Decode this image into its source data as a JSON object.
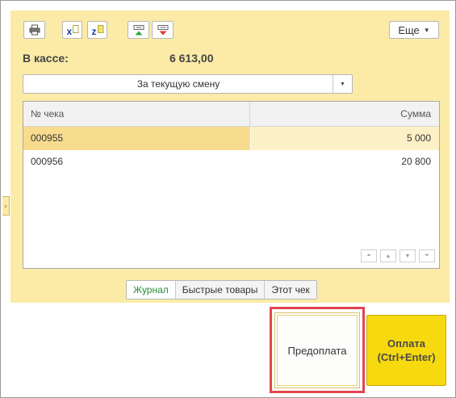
{
  "toolbar": {
    "icons": [
      "printer-icon",
      "excel-export-icon",
      "mxl-export-icon",
      "arrow-up-icon",
      "arrow-down-icon"
    ],
    "more_label": "Еще"
  },
  "cash": {
    "label": "В кассе:",
    "value": "6 613,00"
  },
  "period": {
    "selected": "За текущую смену"
  },
  "table": {
    "columns": [
      "№ чека",
      "Сумма"
    ],
    "rows": [
      {
        "number": "000955",
        "amount": "5 000",
        "selected": true
      },
      {
        "number": "000956",
        "amount": "20 800",
        "selected": false
      }
    ]
  },
  "tabs": [
    {
      "label": "Журнал",
      "active": true
    },
    {
      "label": "Быстрые товары",
      "active": false
    },
    {
      "label": "Этот чек",
      "active": false
    }
  ],
  "buttons": {
    "prepay": "Предоплата",
    "pay_line1": "Оплата",
    "pay_line2": "(Ctrl+Enter)"
  },
  "colors": {
    "panel": "#fbeba7",
    "selected_row": "#f8dc8e",
    "pay_button": "#f7d90f",
    "highlight": "#e2464e",
    "active_tab": "#2a8a3a"
  }
}
